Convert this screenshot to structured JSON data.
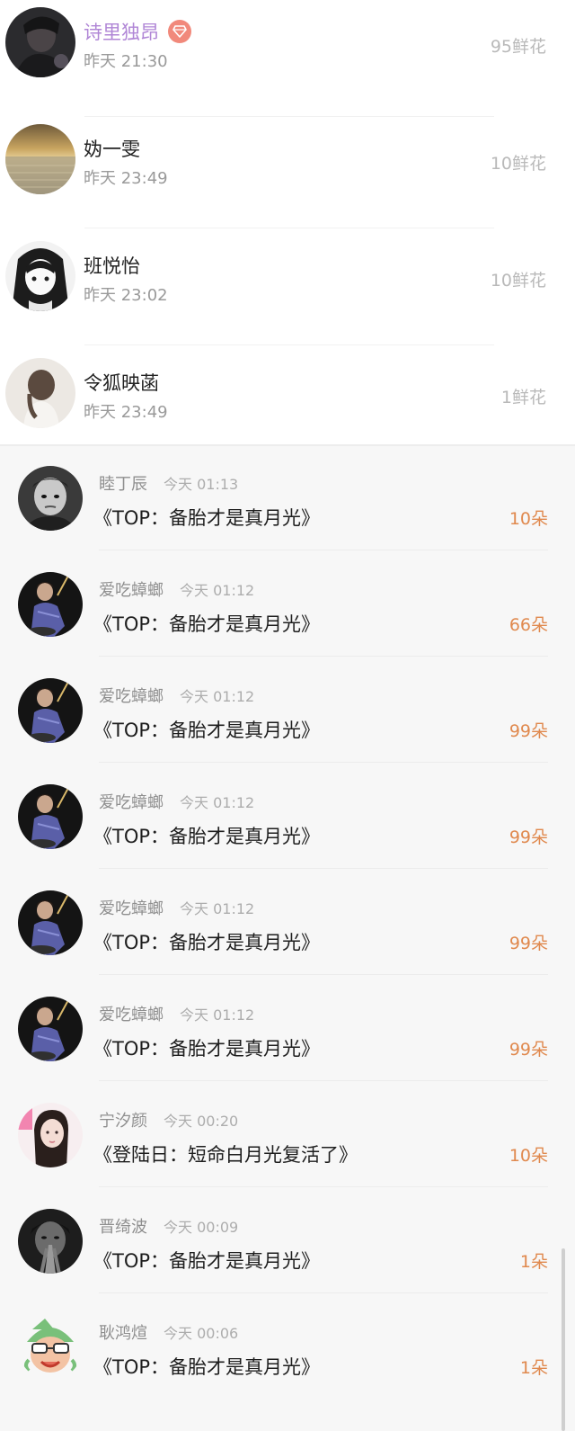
{
  "top_supporters": [
    {
      "name": "诗里独昂",
      "time": "昨天 21:30",
      "amount": "95鲜花",
      "vip": true,
      "avatar": "dark-portrait-avatar"
    },
    {
      "name": "妫一雯",
      "time": "昨天 23:49",
      "amount": "10鲜花",
      "vip": false,
      "avatar": "sea-sunset-avatar"
    },
    {
      "name": "班悦怡",
      "time": "昨天 23:02",
      "amount": "10鲜花",
      "vip": false,
      "avatar": "anime-girl-avatar"
    },
    {
      "name": "令狐映菡",
      "time": "昨天 23:49",
      "amount": "1鲜花",
      "vip": false,
      "avatar": "girl-back-avatar"
    }
  ],
  "gift_records": [
    {
      "user": "睦丁辰",
      "time": "今天 01:13",
      "title": "《TOP：备胎才是真月光》",
      "amount": "10朵",
      "avatar": "child-bw-avatar"
    },
    {
      "user": "爱吃蟑螂",
      "time": "今天 01:12",
      "title": "《TOP：备胎才是真月光》",
      "amount": "66朵",
      "avatar": "drummer-avatar"
    },
    {
      "user": "爱吃蟑螂",
      "time": "今天 01:12",
      "title": "《TOP：备胎才是真月光》",
      "amount": "99朵",
      "avatar": "drummer-avatar"
    },
    {
      "user": "爱吃蟑螂",
      "time": "今天 01:12",
      "title": "《TOP：备胎才是真月光》",
      "amount": "99朵",
      "avatar": "drummer-avatar"
    },
    {
      "user": "爱吃蟑螂",
      "time": "今天 01:12",
      "title": "《TOP：备胎才是真月光》",
      "amount": "99朵",
      "avatar": "drummer-avatar"
    },
    {
      "user": "爱吃蟑螂",
      "time": "今天 01:12",
      "title": "《TOP：备胎才是真月光》",
      "amount": "99朵",
      "avatar": "drummer-avatar"
    },
    {
      "user": "宁汐颜",
      "time": "今天 00:20",
      "title": "《登陆日：短命白月光复活了》",
      "amount": "10朵",
      "avatar": "woman-portrait-avatar"
    },
    {
      "user": "晋绮波",
      "time": "今天 00:09",
      "title": "《TOP：备胎才是真月光》",
      "amount": "1朵",
      "avatar": "man-hands-avatar"
    },
    {
      "user": "耿鸿煊",
      "time": "今天 00:06",
      "title": "《TOP：备胎才是真月光》",
      "amount": "1朵",
      "avatar": "cartoon-avatar"
    }
  ],
  "colors": {
    "vip_name": "#b086d6",
    "vip_badge": "#f1897b",
    "gift_amount": "#e0894e",
    "secondary_text": "#9a9a9a"
  }
}
